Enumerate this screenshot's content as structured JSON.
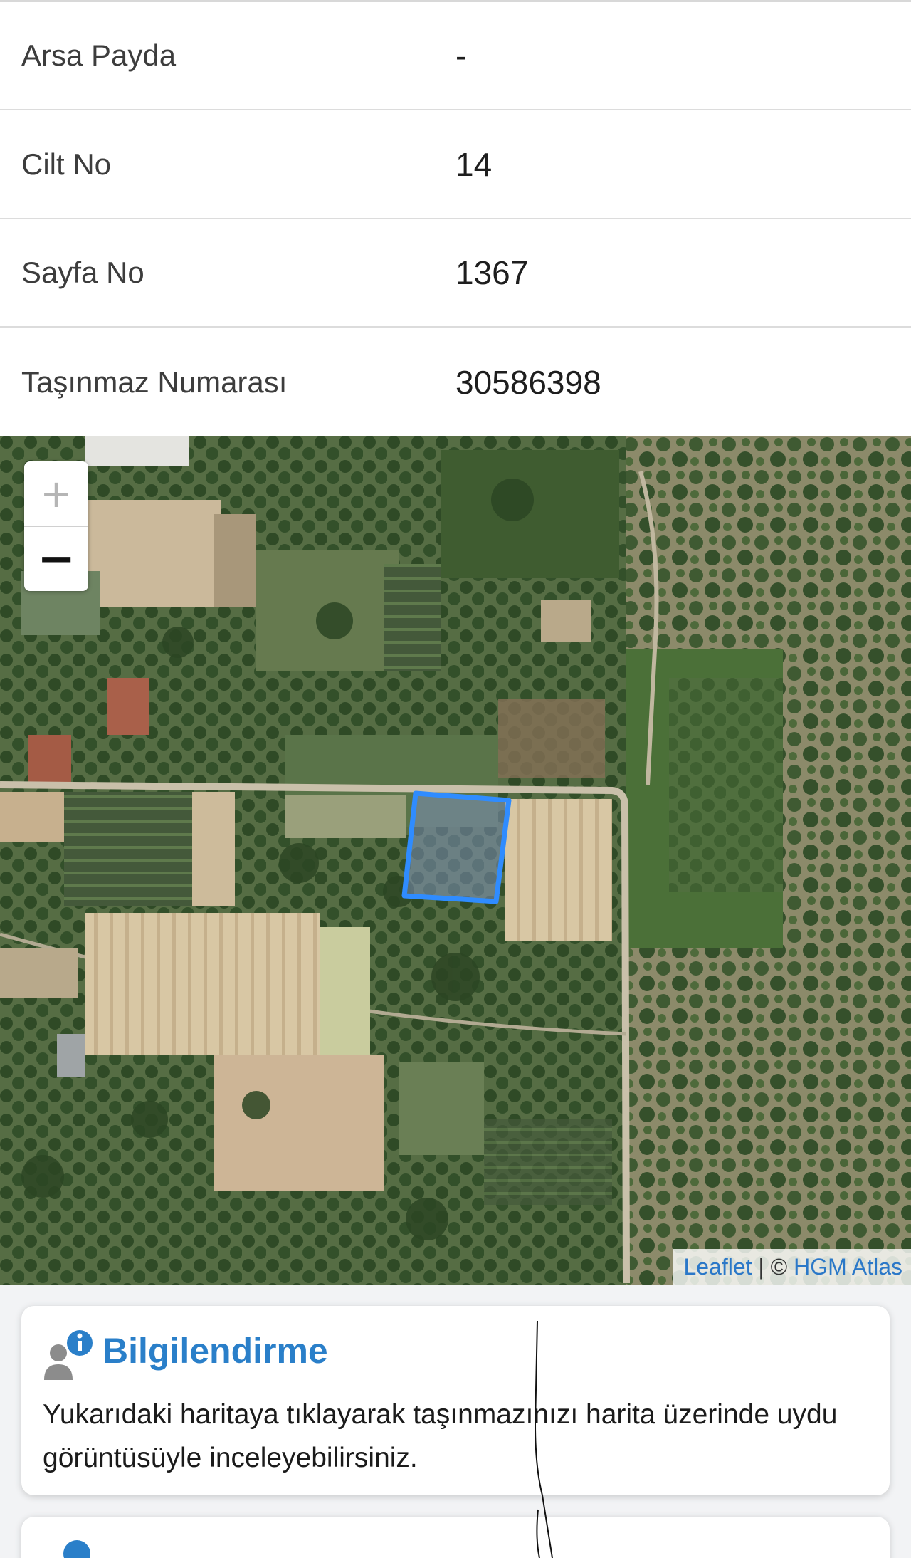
{
  "property_info": [
    {
      "label": "Arsa Payda",
      "value": "-"
    },
    {
      "label": "Cilt No",
      "value": "14"
    },
    {
      "label": "Sayfa No",
      "value": "1367"
    },
    {
      "label": "Taşınmaz Numarası",
      "value": "30586398"
    }
  ],
  "map": {
    "zoom_in_label": "+",
    "zoom_out_label": "−",
    "attribution": {
      "leaflet": "Leaflet",
      "separator": " | © ",
      "provider": "HGM Atlas"
    },
    "parcel_outline_color": "#2f8cff",
    "link_color": "#2b78c8"
  },
  "info_card": {
    "icon": "user-info-icon",
    "title": "Bilgilendirme",
    "text": "Yukarıdaki haritaya tıklayarak taşınmazınızı harita üzerinde uydu görüntüsüyle inceleyebilirsiniz.",
    "accent_color": "#2a7fc9"
  },
  "next_card": {
    "icon": "info-icon"
  }
}
